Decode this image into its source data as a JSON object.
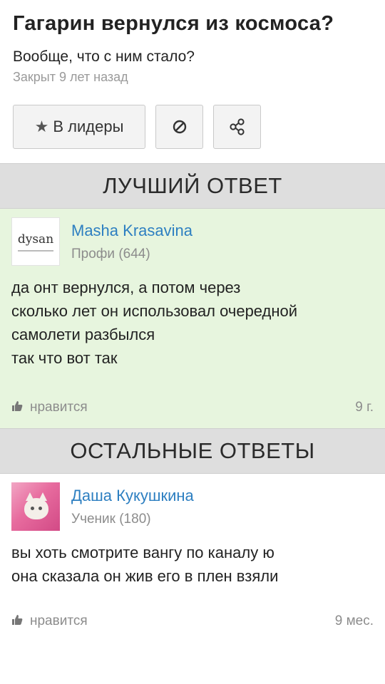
{
  "question": {
    "title": "Гагарин вернулся из космоса?",
    "text": "Вообще, что с ним стало?",
    "meta": "Закрыт 9 лет назад"
  },
  "actions": {
    "leader_label": "В лидеры",
    "leader_icon": "star-icon",
    "block_icon": "block-icon",
    "share_icon": "share-icon"
  },
  "best_answer": {
    "section_title": "ЛУЧШИЙ ОТВЕТ",
    "avatar_text": "dysan",
    "user_name": "Masha Krasavina",
    "user_rank": "Профи (644)",
    "text": "да онт вернулся, а потом через\nсколько лет он использовал очередной\nсамолети разбылся\nтак что вот так",
    "like_label": "нравится",
    "age": "9 г."
  },
  "other_answers": {
    "section_title": "ОСТАЛЬНЫЕ ОТВЕТЫ",
    "items": [
      {
        "user_name": "Даша Кукушкина",
        "user_rank": "Ученик (180)",
        "text": "вы хоть смотрите вангу по каналу ю\nона сказала он жив его в плен взяли",
        "like_label": "нравится",
        "age": "9 мес."
      }
    ]
  },
  "colors": {
    "accent_link": "#2d7fc1",
    "best_bg": "#e7f5de",
    "section_bg": "#dedede"
  }
}
